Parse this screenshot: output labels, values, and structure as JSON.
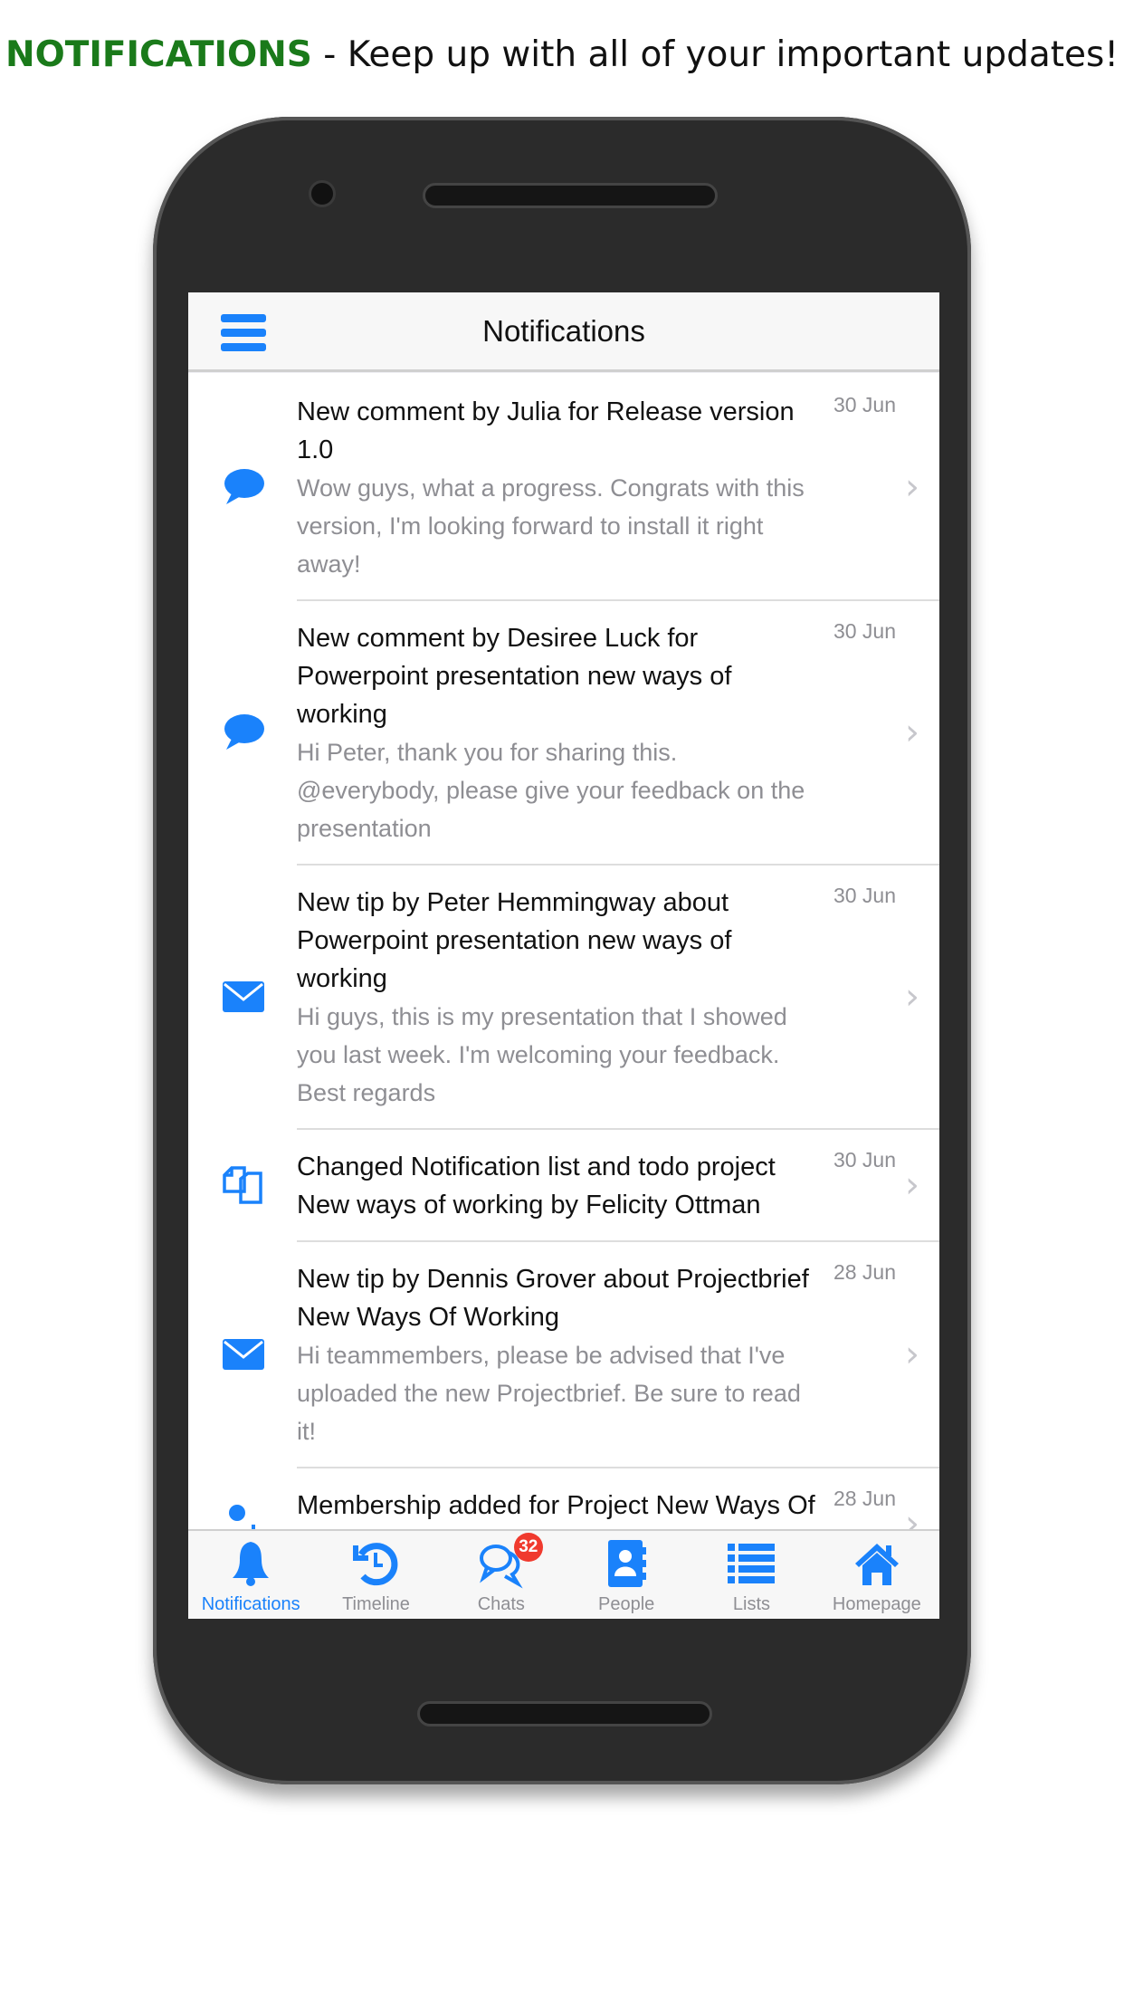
{
  "caption": {
    "highlight": "NOTIFICATIONS",
    "text": " - Keep up with all of your important updates!"
  },
  "header": {
    "title": "Notifications",
    "menu_icon": "hamburger-icon"
  },
  "notifications": [
    {
      "icon": "comment-icon",
      "title": "New comment by Julia for Release version 1.0",
      "date": "30 Jun",
      "preview": "Wow guys, what a progress. Congrats with this version, I'm looking forward to install it right away!"
    },
    {
      "icon": "comment-icon",
      "title": "New comment by Desiree Luck for Powerpoint presentation new ways of working",
      "date": "30 Jun",
      "preview": "Hi Peter, thank you for sharing this. @everybody, please give your feedback on the presentation"
    },
    {
      "icon": "envelope-icon",
      "title": "New tip by Peter Hemmingway about Powerpoint presentation new ways of working",
      "date": "30 Jun",
      "preview": "Hi guys, this is my presentation that I showed you last week. I'm welcoming your feedback. Best regards"
    },
    {
      "icon": "copy-icon",
      "title": "Changed Notification list and todo project New ways of working by Felicity Ottman",
      "date": "30 Jun",
      "preview": ""
    },
    {
      "icon": "envelope-icon",
      "title": "New tip by Dennis Grover about Projectbrief New Ways Of Working",
      "date": "28 Jun",
      "preview": "Hi teammembers, please be advised that I've uploaded the new Projectbrief. Be sure to read it!"
    },
    {
      "icon": "user-plus-icon",
      "title": "Membership added for Project New Ways Of Working by Jennifer Fringe",
      "date": "28 Jun",
      "preview": ""
    }
  ],
  "tabs": [
    {
      "label": "Notifications",
      "icon": "bell-icon",
      "active": true
    },
    {
      "label": "Timeline",
      "icon": "history-icon"
    },
    {
      "label": "Chats",
      "icon": "chats-icon",
      "badge": "32"
    },
    {
      "label": "People",
      "icon": "address-book-icon"
    },
    {
      "label": "Lists",
      "icon": "list-icon"
    },
    {
      "label": "Homepage",
      "icon": "home-icon"
    }
  ],
  "colors": {
    "accent": "#1a82fb",
    "badge": "#f03a2e",
    "caption_highlight": "#1a7a1a"
  }
}
